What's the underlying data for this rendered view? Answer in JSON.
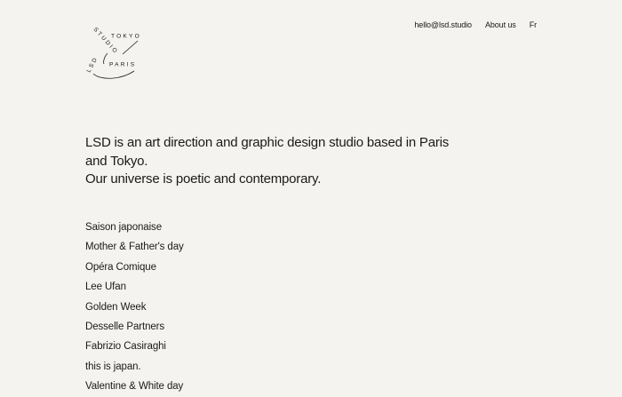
{
  "logo": {
    "word_studio": "STUDIO",
    "word_tokyo": "TOKYO",
    "word_lsd": "LSD",
    "word_paris": "PARIS"
  },
  "nav": {
    "email": "hello@lsd.studio",
    "about": "About us",
    "language": "Fr"
  },
  "intro": {
    "line1": "LSD is an art direction and graphic design studio based in Paris and Tokyo.",
    "line2": "Our universe is poetic and contemporary."
  },
  "projects": [
    "Saison japonaise",
    "Mother & Father's day",
    "Opéra Comique",
    "Lee Ufan",
    "Golden Week",
    "Desselle Partners",
    "Fabrizio Casiraghi",
    "this is japan.",
    "Valentine & White day"
  ]
}
